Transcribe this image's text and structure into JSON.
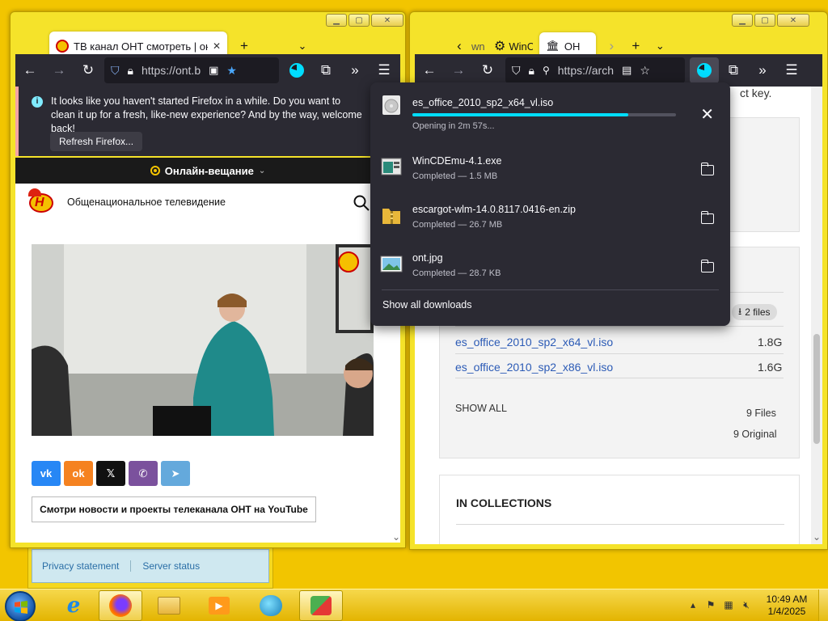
{
  "left_window": {
    "tab": {
      "title": "ТВ канал ОНТ смотреть | онлай"
    },
    "url": "https://ont.b",
    "notification": {
      "message": "It looks like you haven't started Firefox in a while. Do you want to clean it up for a fresh, like-new experience? And by the way, welcome back!",
      "refresh_button": "Refresh Firefox..."
    },
    "live_label": "Онлайн-вещание",
    "site_name": "Общенациональное телевидение",
    "youtube_button": "Смотри новости и проекты телеканала ОНТ на YouTube",
    "share_buttons": [
      "vk",
      "ok",
      "x",
      "viber",
      "telegram"
    ]
  },
  "right_window": {
    "tabs": [
      "wn",
      "WinCl",
      "ОН"
    ],
    "url": "https://arch",
    "partial_text": "ct key.",
    "files_pill": "2 files",
    "files": [
      {
        "name": "es_office_2010_sp2_x64_vl.iso",
        "size": "1.8G"
      },
      {
        "name": "es_office_2010_sp2_x86_vl.iso",
        "size": "1.6G"
      }
    ],
    "show_all": "SHOW ALL",
    "file_count": "9 Files",
    "original_count": "9 Original",
    "collections_heading": "IN COLLECTIONS"
  },
  "downloads": {
    "items": [
      {
        "name": "es_office_2010_sp2_x64_vl.iso",
        "status": "Opening in 2m 57s...",
        "progress": 0.82,
        "icon": "disc-image-icon"
      },
      {
        "name": "WinCDEmu-4.1.exe",
        "status": "Completed — 1.5 MB",
        "icon": "installer-icon"
      },
      {
        "name": "escargot-wlm-14.0.8117.0416-en.zip",
        "status": "Completed — 26.7 MB",
        "icon": "zip-folder-icon"
      },
      {
        "name": "ont.jpg",
        "status": "Completed — 28.7 KB",
        "icon": "image-file-icon"
      }
    ],
    "show_all": "Show all downloads"
  },
  "desktop_window": {
    "privacy": "Privacy statement",
    "server_status": "Server status"
  },
  "taskbar": {
    "time": "10:49 AM",
    "date": "1/4/2025"
  },
  "colors": {
    "desktop": "#f2c500",
    "firefox_dark": "#2b2a33",
    "progress": "#00ddff",
    "link": "#2c5bb6"
  }
}
